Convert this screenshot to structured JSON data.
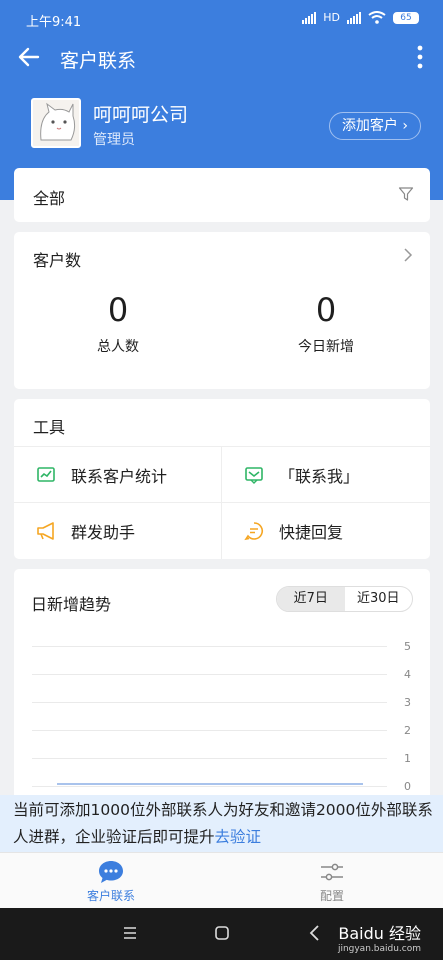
{
  "status_bar": {
    "time": "上午9:41",
    "network": "HD",
    "battery": "65"
  },
  "app_bar": {
    "title": "客户联系"
  },
  "company": {
    "name": "呵呵呵公司",
    "role": "管理员",
    "add_button": "添加客户 ›"
  },
  "filter": {
    "label": "全部"
  },
  "customer_count": {
    "title": "客户数",
    "stats": [
      {
        "value": "0",
        "label": "总人数"
      },
      {
        "value": "0",
        "label": "今日新增"
      }
    ]
  },
  "tools": {
    "title": "工具",
    "items": [
      {
        "label": "联系客户统计",
        "icon": "chart-icon"
      },
      {
        "label": "「联系我」",
        "icon": "message-icon"
      },
      {
        "label": "群发助手",
        "icon": "megaphone-icon"
      },
      {
        "label": "快捷回复",
        "icon": "quick-reply-icon"
      }
    ]
  },
  "trend": {
    "title": "日新增趋势",
    "ranges": [
      "近7日",
      "近30日"
    ],
    "active_range": "近7日",
    "y_ticks": [
      "5",
      "4",
      "3",
      "2",
      "1",
      "0"
    ]
  },
  "notice": {
    "text": "当前可添加1000位外部联系人为好友和邀请2000位外部联系人进群，企业验证后即可提升",
    "link": "去验证"
  },
  "bottom_nav": [
    {
      "label": "客户联系",
      "active": true
    },
    {
      "label": "配置",
      "active": false
    }
  ],
  "watermark": {
    "brand": "Baidu 经验",
    "url": "jingyan.baidu.com"
  },
  "colors": {
    "primary": "#3c7ede",
    "green": "#2fb566",
    "orange": "#f5a623",
    "notice_bg": "#e3effd"
  }
}
